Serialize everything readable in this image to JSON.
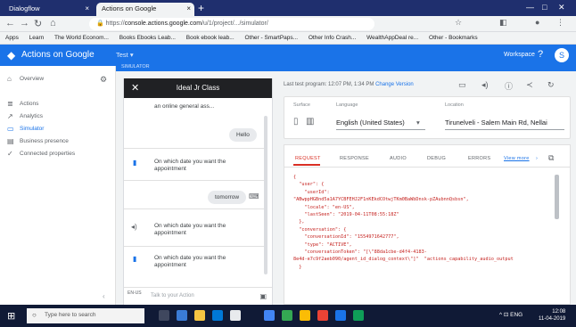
{
  "browser": {
    "tabs": [
      {
        "label": "Dialogflow"
      },
      {
        "label": "Actions on Google"
      }
    ],
    "new_tab": "+",
    "omnibox": {
      "prefix": "https://",
      "host": "console.actions.google.com",
      "path": "/u/1/project/.../simulator/"
    },
    "bookmarks": [
      "Apps",
      "Learn",
      "The World Econom...",
      "Books Ebooks Leab...",
      "Book ebook leab...",
      "Other - SmartPaps...",
      "Other Info Crash...",
      "WealthAppDeal re...",
      "Other - Bookmarks"
    ]
  },
  "app": {
    "title": "Actions on Google",
    "project": "Test ▾",
    "subbar": "SIMULATOR",
    "workspace": "Workspace",
    "help_icon": "?",
    "avatar_letter": "S"
  },
  "leftnav": {
    "items": [
      {
        "label": "Overview",
        "icon": "⌂",
        "active": false
      },
      {
        "label": "Actions",
        "icon": "≣",
        "active": false
      },
      {
        "label": "Analytics",
        "icon": "↗",
        "active": false
      },
      {
        "label": "Simulator",
        "icon": "▭",
        "active": true
      },
      {
        "label": "Business presence",
        "icon": "▤",
        "active": false
      },
      {
        "label": "Connected properties",
        "icon": "✓",
        "active": false
      }
    ]
  },
  "chat": {
    "header_title": "Ideal Jr Class",
    "messages": [
      {
        "type": "bot-partial",
        "text": "an online general ass..."
      },
      {
        "type": "user",
        "text": "Hello"
      },
      {
        "type": "bot",
        "text": "On which date you want the appointment"
      },
      {
        "type": "user",
        "text": "tomorrow"
      },
      {
        "type": "bot",
        "text": "On which date you want the appointment"
      },
      {
        "type": "bot",
        "text": "On which date you want the appointment"
      }
    ],
    "input_lang": "EN-US",
    "input_placeholder": "Talk to your Action",
    "mic_icon": "🎤"
  },
  "right": {
    "last_updated": "Last test program: 12:07 PM, 1:34 PM",
    "change_version": "Change Version",
    "settings": {
      "surface_label": "Surface",
      "language_label": "Language",
      "language_value": "English (United States)",
      "location_label": "Location",
      "location_value": "Tirunelveli - Salem Main Rd, Nellai"
    },
    "tabs": [
      "REQUEST",
      "RESPONSE",
      "AUDIO",
      "DEBUG",
      "ERRORS",
      "View more"
    ],
    "json_lines": [
      "{",
      "  \"user\": {",
      "    \"userId\":",
      "\"ABwppHGBnd5a1A7YCBFEHJ2F1nKEkdCOtwjTKm0BaWbDnsk-pZAubnnQsbsn\",",
      "    \"locale\": \"en-US\",",
      "    \"lastSeen\": \"2019-04-11T08:55:18Z\"",
      "  },",
      "  \"conversation\": {",
      "    \"conversationId\": \"1554971642777\",",
      "    \"type\": \"ACTIVE\",",
      "    \"conversationToken\": \"[\\\"88da1cbe-d4f4-4183-",
      "8e4d-e7c9f2aeb090/agent_id_dialog_context\\\"]\"  \"actions_capability_audio_output",
      "  }"
    ]
  },
  "taskbar": {
    "search_placeholder": "Type here to search",
    "tray": "^ ⊡ ENG",
    "clock_time": "12:08",
    "clock_date": "11-04-2019"
  },
  "colors": {
    "brand": "#1a73e8",
    "json_key": "#c5221f",
    "tab_active": "#d93025"
  }
}
